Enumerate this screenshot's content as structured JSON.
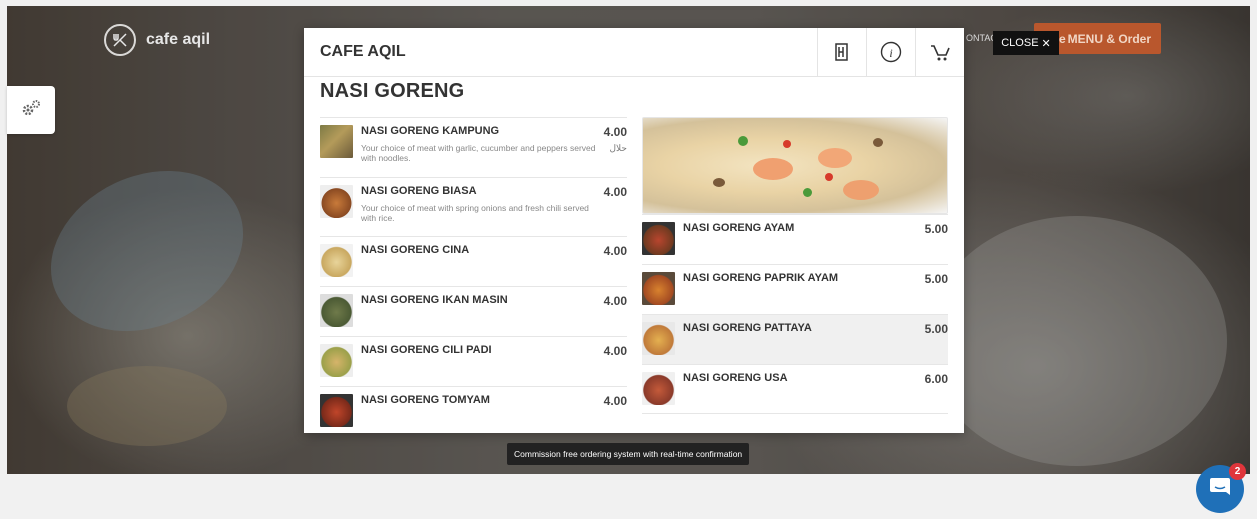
{
  "brand": {
    "name": "cafe aqil"
  },
  "nav": {
    "contact": "ONTACT",
    "menu_order_label": "MENU & Order",
    "menu_order_prefix": "e"
  },
  "modal": {
    "close_label": "CLOSE",
    "title": "CAFE AQIL",
    "section_title": "NASI GORENG",
    "icons": [
      "menu-book-icon",
      "info-icon",
      "cart-icon"
    ],
    "left_items": [
      {
        "name": "NASI GORENG KAMPUNG",
        "price": "4.00",
        "desc": "Your choice of meat with garlic, cucumber and peppers served with noodles.",
        "badge": "حلال"
      },
      {
        "name": "NASI GORENG BIASA",
        "price": "4.00",
        "desc": "Your choice of meat with spring onions and fresh chili served with rice."
      },
      {
        "name": "NASI GORENG CINA",
        "price": "4.00"
      },
      {
        "name": "NASI GORENG IKAN MASIN",
        "price": "4.00"
      },
      {
        "name": "NASI GORENG CILI PADI",
        "price": "4.00"
      },
      {
        "name": "NASI GORENG TOMYAM",
        "price": "4.00"
      }
    ],
    "right_items": [
      {
        "name": "NASI GORENG AYAM",
        "price": "5.00"
      },
      {
        "name": "NASI GORENG PAPRIK AYAM",
        "price": "5.00"
      },
      {
        "name": "NASI GORENG PATTAYA",
        "price": "5.00"
      },
      {
        "name": "NASI GORENG USA",
        "price": "6.00"
      }
    ]
  },
  "tooltip": "Commission free ordering system with real-time confirmation",
  "chat": {
    "badge_count": "2"
  },
  "colors": {
    "accent": "#b9572d",
    "chat": "#1f70b8",
    "badge": "#e0353b"
  }
}
